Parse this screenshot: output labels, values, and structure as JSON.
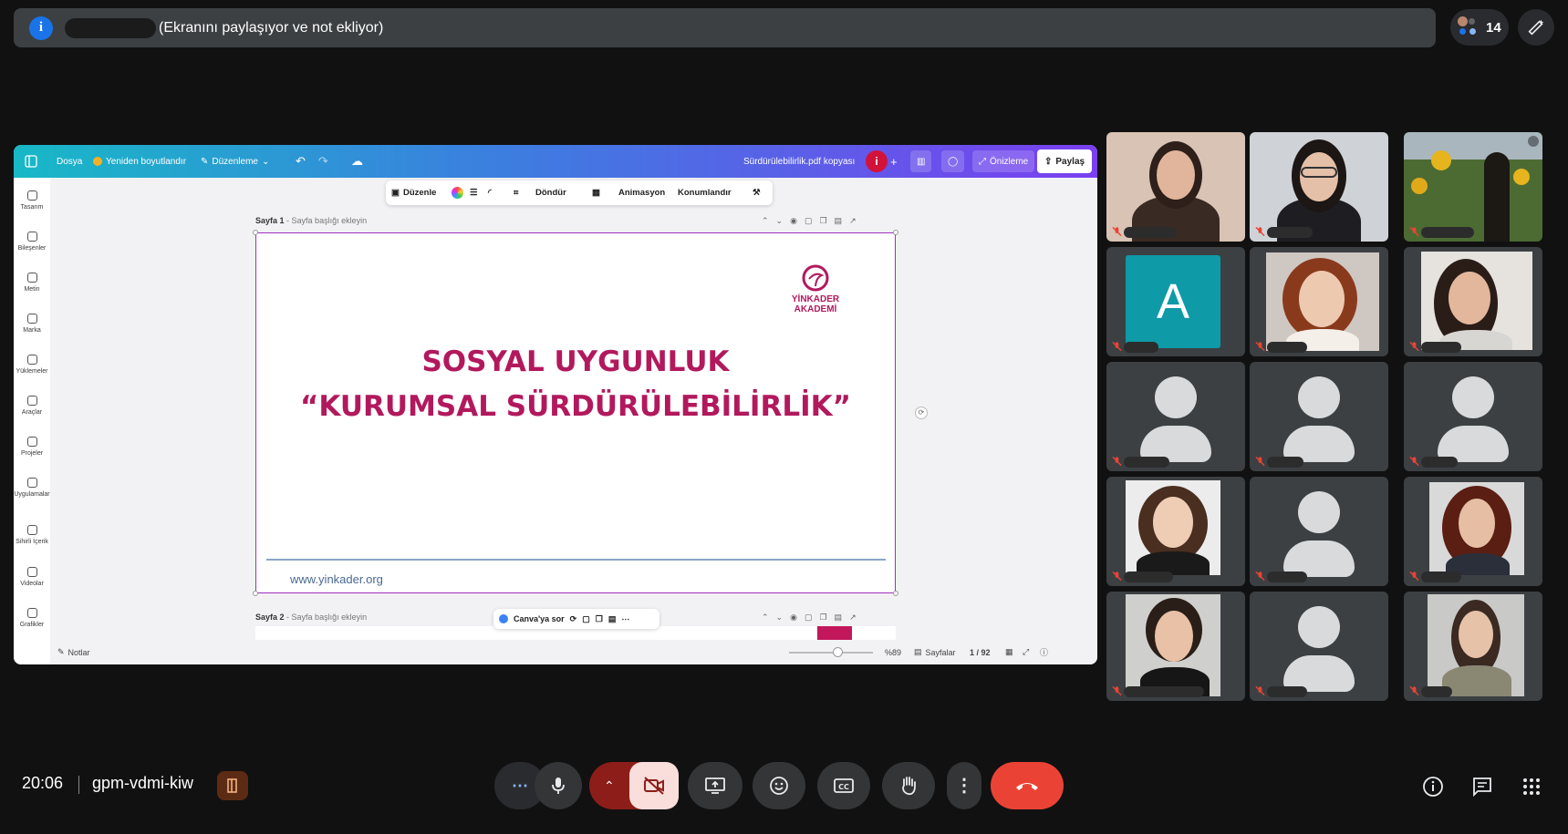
{
  "banner": {
    "text": "(Ekranını paylaşıyor ve not ekliyor)",
    "info_icon": "i"
  },
  "participants_count": "14",
  "canva": {
    "menu_file": "Dosya",
    "resize": "Yeniden boyutlandır",
    "editing": "Düzenleme",
    "doc_title": "Sürdürülebilirlik.pdf kopyası",
    "badge": "i",
    "preview": "Önizleme",
    "share": "Paylaş",
    "sidebar": [
      "Tasarım",
      "Bileşenler",
      "Metin",
      "Marka",
      "Yüklemeler",
      "Araçlar",
      "Projeler",
      "Uygulamalar",
      "Sihirli İçerik",
      "Videolar",
      "Grafikler"
    ],
    "toolbar": {
      "edit": "Düzenle",
      "rotate": "Döndür",
      "animation": "Animasyon",
      "position": "Konumlandır"
    },
    "page1_label": "Sayfa 1",
    "page1_hint": "- Sayfa başlığı ekleyin",
    "page2_label": "Sayfa 2",
    "page2_hint": "- Sayfa başlığı ekleyin",
    "slide": {
      "title_line1": "SOSYAL UYGUNLUK",
      "title_line2": "“KURUMSAL SÜRDÜRÜLEBİLİRLİK”",
      "url": "www.yinkader.org",
      "logo_line1": "YİNKADER",
      "logo_line2": "AKADEMİ"
    },
    "ask_canva": "Canva'ya sor",
    "notes": "Notlar",
    "zoom": "%89",
    "pages": "Sayfalar",
    "page_count": "1 / 92"
  },
  "tile_avatar_letter": "A",
  "footer": {
    "time": "20:06",
    "meeting_code": "gpm-vdmi-kiw"
  },
  "colors": {
    "slide_title": "#b2195d",
    "end_call": "#ea4335",
    "camera_off": "#f9dedc",
    "avatar_teal": "#0e9aa7"
  }
}
